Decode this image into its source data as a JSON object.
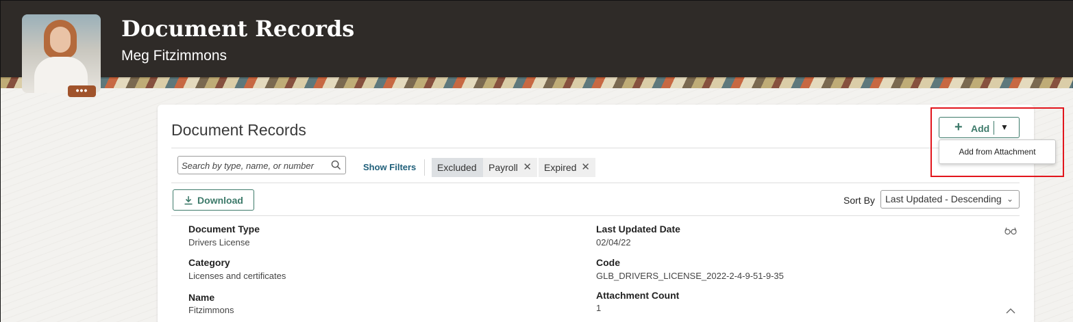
{
  "header": {
    "title": "Document Records",
    "person_name": "Meg Fitzimmons",
    "more_label": "•••"
  },
  "card": {
    "title": "Document Records",
    "add_button": {
      "label": "Add",
      "plus": "+",
      "caret": "▼"
    },
    "add_menu": {
      "items": [
        "Add from Attachment"
      ]
    },
    "search": {
      "placeholder": "Search by type, name, or number",
      "value": ""
    },
    "show_filters_label": "Show Filters",
    "filter_chips": [
      {
        "label": "Excluded"
      },
      {
        "label": "Payroll",
        "remove": "✕"
      },
      {
        "label": "Expired",
        "remove": "✕"
      }
    ],
    "download_label": "Download",
    "sort": {
      "label": "Sort By",
      "selected": "Last Updated - Descending",
      "chevron": "⌄"
    }
  },
  "record": {
    "document_type_label": "Document Type",
    "document_type_value": "Drivers License",
    "category_label": "Category",
    "category_value": "Licenses and certificates",
    "name_label": "Name",
    "name_value": "Fitzimmons",
    "last_updated_label": "Last Updated Date",
    "last_updated_value": "02/04/22",
    "code_label": "Code",
    "code_value": "GLB_DRIVERS_LICENSE_2022-2-4-9-51-9-35",
    "attachment_count_label": "Attachment Count",
    "attachment_count_value": "1"
  },
  "icons": {
    "search": "search-icon",
    "download": "download-icon",
    "glasses": "glasses-icon",
    "collapse": "chevron-up-icon"
  },
  "colors": {
    "header_bg": "#2f2b28",
    "accent": "#3d7a6a",
    "link": "#1f5f7a",
    "highlight": "#e2141b",
    "more_button": "#a0532b"
  }
}
